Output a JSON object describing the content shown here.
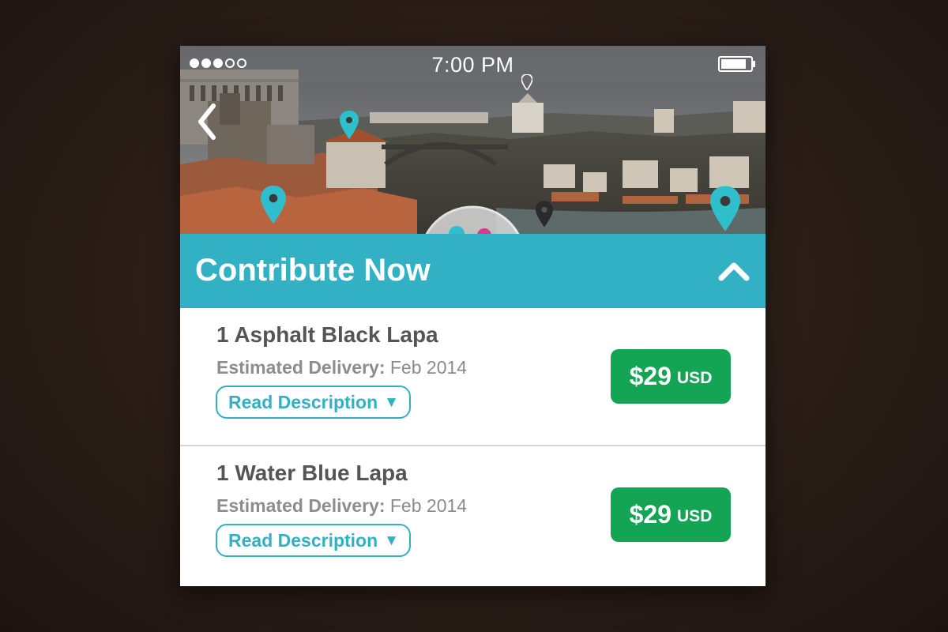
{
  "status_bar": {
    "signal_total": 5,
    "signal_filled": 3,
    "time": "7:00 PM",
    "battery_level": 0.85
  },
  "hero": {
    "back_icon": "chevron-left-icon",
    "map_pin_icon": "map-pin-icon",
    "pin_color": "#2fbfcc"
  },
  "header": {
    "title": "Contribute Now",
    "toggle_icon": "chevron-up-icon",
    "background_color": "#33b1c4"
  },
  "rewards": [
    {
      "title": "1 Asphalt Black Lapa",
      "delivery_label": "Estimated Delivery:",
      "delivery_value": "Feb 2014",
      "read_label": "Read Description",
      "read_icon": "triangle-down-icon",
      "price": "$29",
      "currency": "USD"
    },
    {
      "title": "1 Water Blue Lapa",
      "delivery_label": "Estimated Delivery:",
      "delivery_value": "Feb 2014",
      "read_label": "Read Description",
      "read_icon": "triangle-down-icon",
      "price": "$29",
      "currency": "USD"
    }
  ],
  "colors": {
    "price_button": "#13a454",
    "accent": "#33b1c4"
  }
}
